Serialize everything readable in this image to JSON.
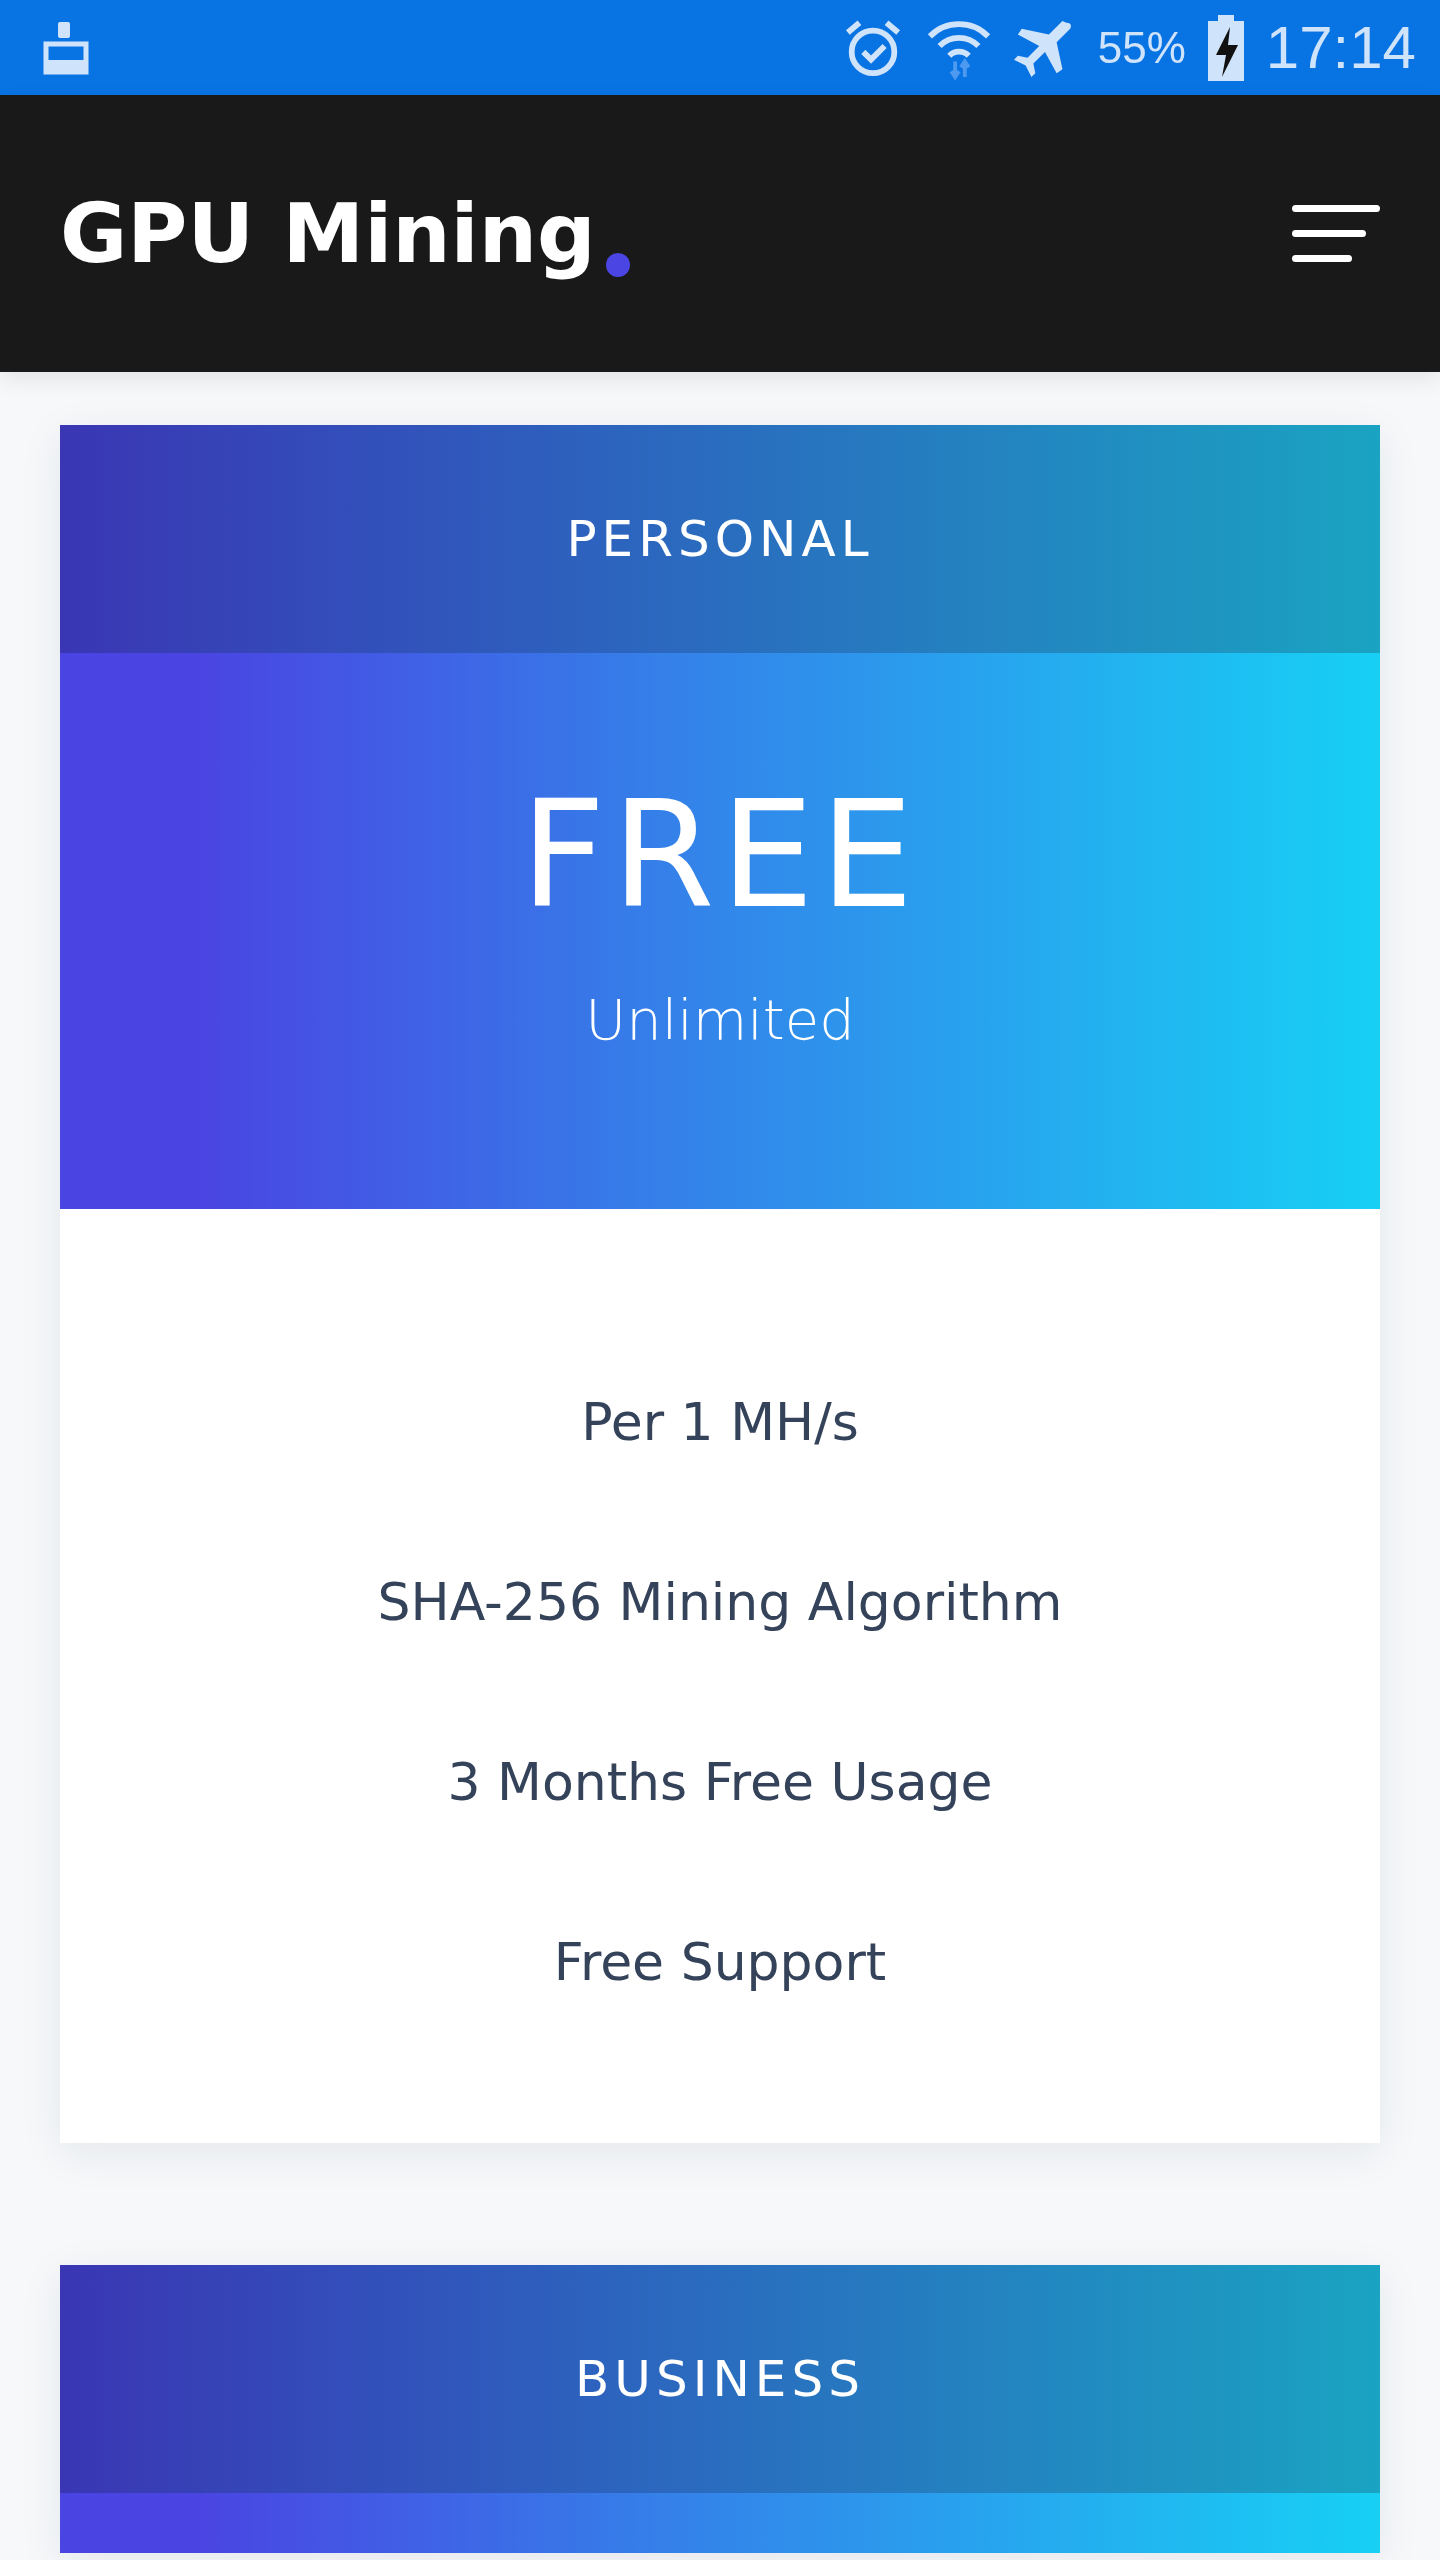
{
  "status_bar": {
    "battery": "55%",
    "time": "17:14"
  },
  "header": {
    "logo": "GPU Mining"
  },
  "plans": [
    {
      "name": "PERSONAL",
      "price": "FREE",
      "period": "Unlimited",
      "features": [
        "Per 1 MH/s",
        "SHA-256 Mining Algorithm",
        "3 Months Free Usage",
        "Free Support"
      ]
    },
    {
      "name": "BUSINESS"
    }
  ]
}
